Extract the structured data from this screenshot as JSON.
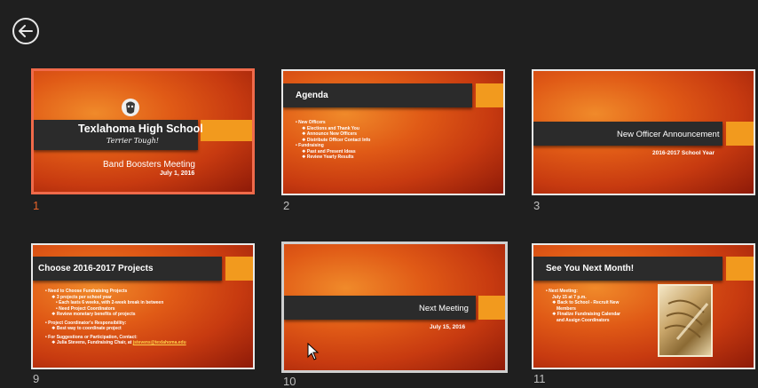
{
  "slides": [
    {
      "number": "1",
      "school": "Texlahoma High School",
      "tagline": "Terrier Tough!",
      "title": "Band Boosters Meeting",
      "subtitle": "July 1, 2016"
    },
    {
      "number": "2",
      "title": "Agenda",
      "bullets": [
        {
          "level": 1,
          "text": "New Officers"
        },
        {
          "level": 2,
          "text": "Elections and Thank You"
        },
        {
          "level": 2,
          "text": "Announce New Officers"
        },
        {
          "level": 2,
          "text": "Distribute Officer Contact Info"
        },
        {
          "level": 1,
          "text": "Fundraising"
        },
        {
          "level": 2,
          "text": "Past and Present Ideas"
        },
        {
          "level": 2,
          "text": "Review Yearly Results"
        }
      ]
    },
    {
      "number": "3",
      "title": "New Officer Announcement",
      "subtitle": "2016-2017 School Year"
    },
    {
      "number": "9",
      "title": "Choose 2016-2017 Projects",
      "bullets": [
        {
          "level": 1,
          "text": "Need to Choose Fundraising Projects"
        },
        {
          "level": 2,
          "text": "3 projects per school year"
        },
        {
          "level": 3,
          "text": "Each lasts 6 weeks, with 2-week break in between"
        },
        {
          "level": 3,
          "text": "Need Project Coordinators"
        },
        {
          "level": 2,
          "text": "Review monetary benefits of projects"
        },
        {
          "level": 0,
          "text": ""
        },
        {
          "level": 1,
          "text": "Project Coordinator's Responsibility:"
        },
        {
          "level": 2,
          "text": "Best way to coordinate project"
        },
        {
          "level": 0,
          "text": ""
        },
        {
          "level": 1,
          "text": "For Suggestions or Participation, Contact:"
        }
      ],
      "contact_text": "Julia Stevens, Fundraising Chair, at ",
      "contact_link": "jstevens@texlahoma.edu"
    },
    {
      "number": "10",
      "title": "Next Meeting",
      "subtitle": "July 15, 2016"
    },
    {
      "number": "11",
      "title": "See You Next Month!",
      "bullets": [
        {
          "level": 1,
          "text": "Next Meeting:"
        },
        {
          "level": 2,
          "text": "July 15 at 7 p.m."
        },
        {
          "level": 2,
          "text": "Back to School - Recruit New"
        },
        {
          "level": 3,
          "text": "Members"
        },
        {
          "level": 2,
          "text": "Finalize Fundraising Calendar"
        },
        {
          "level": 3,
          "text": "and Assign Coordinators"
        }
      ]
    }
  ],
  "colors": {
    "background": "#1f1f1f",
    "bar": "#2b2b2b",
    "accent": "#f29a1e",
    "selected_border": "#f06a4a",
    "active_number": "#e8632a"
  }
}
